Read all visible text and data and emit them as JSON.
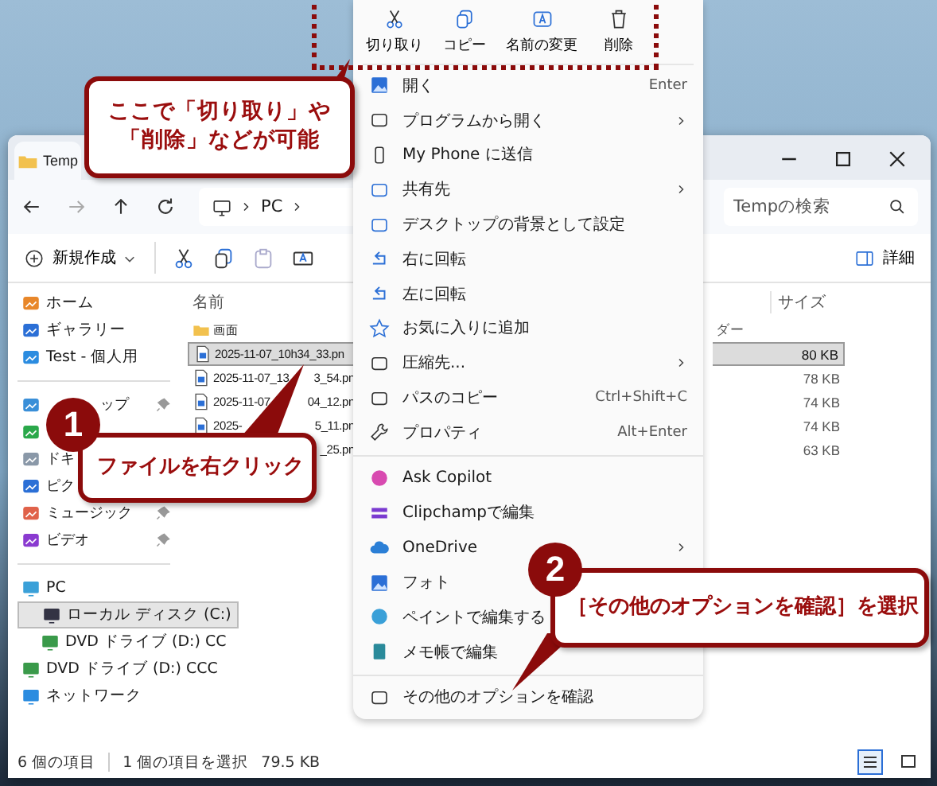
{
  "explorer": {
    "tab_title": "Temp",
    "address_segment": "PC",
    "search_placeholder": "Tempの検索",
    "new_button": "新規作成",
    "details_button": "詳細",
    "sidebar_groups": [
      [
        {
          "label": "ホーム",
          "pinned": false,
          "selected": false
        },
        {
          "label": "ギャラリー",
          "pinned": false,
          "selected": false
        },
        {
          "label": "Test - 個人用",
          "pinned": false,
          "selected": false
        }
      ],
      [
        {
          "label": "ップ",
          "pinned": true,
          "selected": false
        },
        {
          "pinned": false,
          "selected": false
        },
        {
          "label": "ドキ",
          "selected": false
        },
        {
          "label": "ピク",
          "selected": false
        },
        {
          "label": "ミュージック",
          "pinned": true,
          "selected": false
        },
        {
          "label": "ビデオ",
          "pinned": true,
          "selected": false
        }
      ],
      [
        {
          "label": "PC",
          "pinned": false,
          "selected": false,
          "children": [
            {
              "label": "ローカル ディスク (C:)",
              "pinned": false,
              "selected": true
            },
            {
              "label": "DVD ドライブ (D:) CC",
              "pinned": false,
              "selected": false
            }
          ]
        },
        {
          "label": "DVD ドライブ (D:) CCC",
          "pinned": false,
          "selected": false
        },
        {
          "label": "ネットワーク",
          "pinned": false,
          "selected": false
        }
      ]
    ],
    "columns": {
      "name": "名前",
      "size": "サイズ"
    },
    "rows": [
      {
        "kind": "folder",
        "name": "画面",
        "type": "ダー",
        "selected": false
      },
      {
        "kind": "file",
        "name": "2025-11-07_10h34_33.pn",
        "size": "80 KB",
        "selected": true
      },
      {
        "kind": "file",
        "name": "2025-11-07_13",
        "name_tail": "3_54.pn",
        "size": "78 KB",
        "selected": false
      },
      {
        "kind": "file",
        "name": "2025-11-07",
        "name_tail": "04_12.pn",
        "size": "74 KB",
        "selected": false
      },
      {
        "kind": "file",
        "name": "2025-",
        "name_tail": "5_11.pn",
        "size": "74 KB",
        "selected": false
      },
      {
        "kind": "file",
        "name_tail": "_25.pn",
        "size": "63 KB",
        "selected": false
      }
    ],
    "status": {
      "count": "6 個の項目",
      "selection": "1 個の項目を選択",
      "selection_size": "79.5 KB"
    },
    "views": [
      {
        "selected": true
      },
      {
        "selected": false
      }
    ]
  },
  "context_menu": {
    "actions": [
      {
        "label": "切り取り"
      },
      {
        "label": "コピー"
      },
      {
        "label": "名前の変更"
      },
      {
        "label": "削除"
      }
    ],
    "groups": [
      [
        {
          "label": "開く",
          "shortcut": "Enter",
          "submenu": false
        },
        {
          "label": "プログラムから開く",
          "submenu": true
        },
        {
          "label": "My Phone に送信",
          "submenu": false
        },
        {
          "label": "共有先",
          "submenu": true
        },
        {
          "label": "デスクトップの背景として設定",
          "submenu": false
        },
        {
          "label": "右に回転",
          "submenu": false
        },
        {
          "label": "左に回転",
          "submenu": false
        },
        {
          "label": "お気に入りに追加",
          "submenu": false
        },
        {
          "label": "圧縮先...",
          "submenu": true
        },
        {
          "label": "パスのコピー",
          "shortcut": "Ctrl+Shift+C",
          "submenu": false
        },
        {
          "label": "プロパティ",
          "shortcut": "Alt+Enter",
          "submenu": false
        }
      ],
      [
        {
          "label": "Ask Copilot",
          "submenu": false
        },
        {
          "label": "Clipchampで編集",
          "submenu": false
        },
        {
          "label": "OneDrive",
          "submenu": true
        },
        {
          "label": "フォト"
        },
        {
          "label": "ペイントで編集する"
        },
        {
          "label": "メモ帳で編集",
          "submenu": false
        }
      ],
      [
        {
          "label": "その他のオプションを確認",
          "submenu": false
        }
      ]
    ]
  },
  "callouts": [
    {
      "lines": [
        "ここで「切り取り」や",
        "「削除」などが可能"
      ]
    },
    {
      "step": "1",
      "lines": [
        "ファイルを右クリック"
      ]
    },
    {
      "step": "2",
      "lines": [
        "［その他のオプションを確認］を選択"
      ]
    }
  ]
}
